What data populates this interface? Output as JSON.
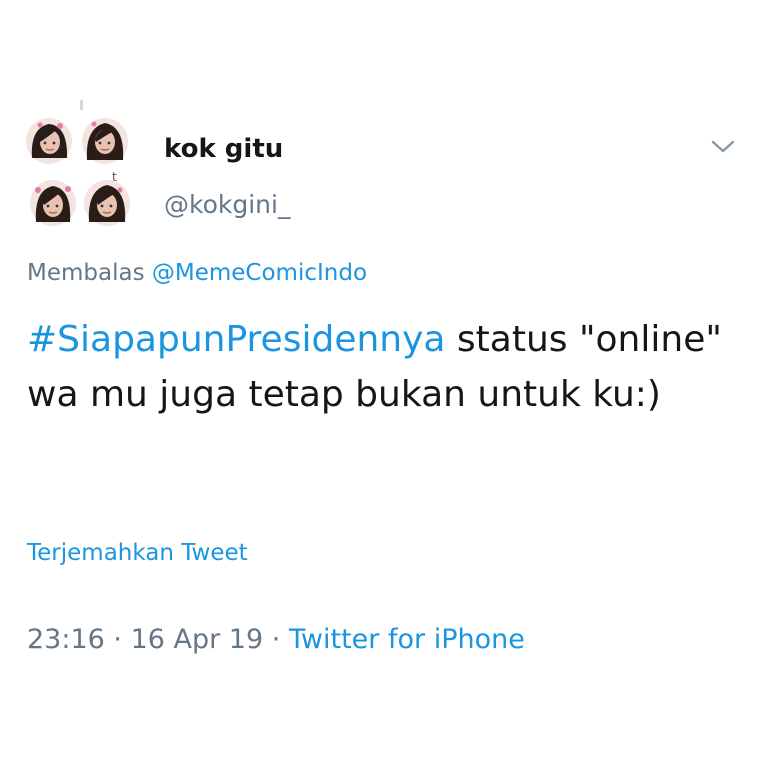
{
  "tweet": {
    "display_name": "kok gitu",
    "handle": "@kokgini_",
    "avatar_mark": "t",
    "reply_prefix": "Membalas",
    "reply_to": "@MemeComicIndo",
    "hashtag": "#SiapapunPresidennya",
    "text_after_hashtag": " status \"online\" wa mu juga tetap bukan untuk ku:)",
    "translate_label": "Terjemahkan Tweet",
    "time": "23:16",
    "separator": " · ",
    "date": "16 Apr 19",
    "source": "Twitter for iPhone"
  },
  "icons": {
    "menu": "chevron-down-icon"
  },
  "colors": {
    "link": "#1b95e0",
    "text": "#14171a",
    "muted": "#657786"
  }
}
